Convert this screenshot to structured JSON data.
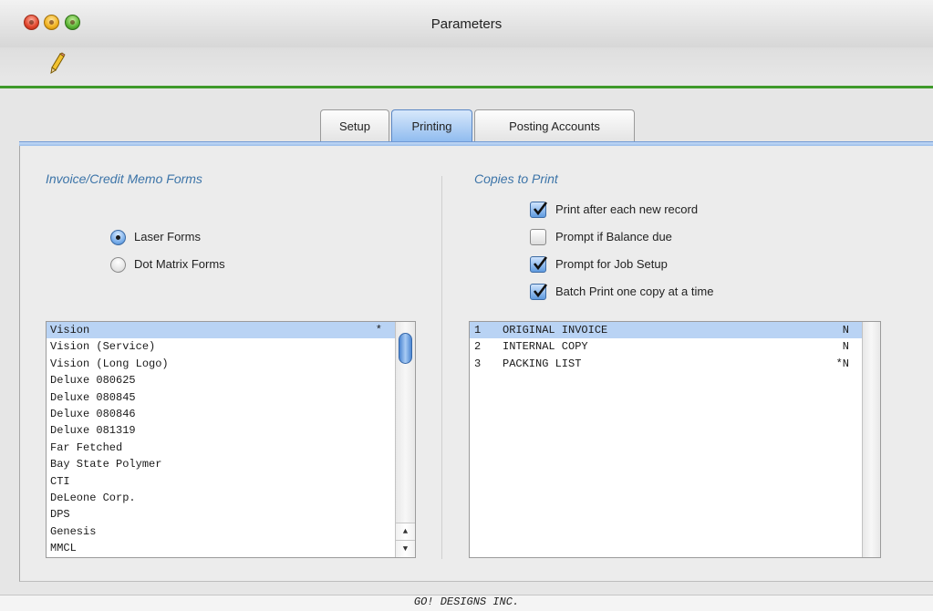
{
  "window": {
    "title": "Parameters"
  },
  "toolbar": {
    "icons": [
      "pencil-icon"
    ]
  },
  "tabs": [
    {
      "label": "Setup",
      "active": false
    },
    {
      "label": "Printing",
      "active": true
    },
    {
      "label": "Posting Accounts",
      "active": false
    }
  ],
  "left": {
    "title": "Invoice/Credit Memo Forms",
    "radios": [
      {
        "label": "Laser Forms",
        "checked": true
      },
      {
        "label": "Dot Matrix Forms",
        "checked": false
      }
    ],
    "forms": [
      {
        "name": "Vision",
        "flag": "*",
        "selected": true
      },
      {
        "name": "Vision (Service)",
        "flag": ""
      },
      {
        "name": "Vision (Long Logo)",
        "flag": ""
      },
      {
        "name": "Deluxe 080625",
        "flag": ""
      },
      {
        "name": "Deluxe 080845",
        "flag": ""
      },
      {
        "name": "Deluxe 080846",
        "flag": ""
      },
      {
        "name": "Deluxe 081319",
        "flag": ""
      },
      {
        "name": "Far Fetched",
        "flag": ""
      },
      {
        "name": "Bay State Polymer",
        "flag": ""
      },
      {
        "name": "CTI",
        "flag": ""
      },
      {
        "name": "DeLeone Corp.",
        "flag": ""
      },
      {
        "name": "DPS",
        "flag": ""
      },
      {
        "name": "Genesis",
        "flag": ""
      },
      {
        "name": "MMCL",
        "flag": ""
      }
    ]
  },
  "right": {
    "title": "Copies to Print",
    "checkboxes": [
      {
        "label": "Print after each new record",
        "checked": true
      },
      {
        "label": "Prompt if Balance due",
        "checked": false
      },
      {
        "label": "Prompt for Job Setup",
        "checked": true
      },
      {
        "label": "Batch Print one copy at a time",
        "checked": true
      }
    ],
    "copies": [
      {
        "number": "1",
        "description": "ORIGINAL INVOICE",
        "code": "N",
        "selected": true
      },
      {
        "number": "2",
        "description": "INTERNAL COPY",
        "code": "N"
      },
      {
        "number": "3",
        "description": "PACKING LIST",
        "code": "*N"
      }
    ]
  },
  "status": {
    "text": "GO! DESIGNS INC."
  },
  "colors": {
    "accent_green": "#3f9a2b",
    "selection_blue": "#b9d3f4",
    "section_title": "#3c74a8"
  }
}
